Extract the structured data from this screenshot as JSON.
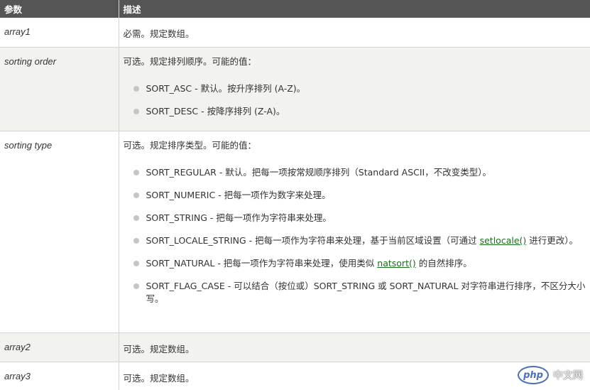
{
  "header": {
    "col_param": "参数",
    "col_desc": "描述"
  },
  "rows": [
    {
      "param": "array1",
      "desc": "必需。规定数组。"
    },
    {
      "param": "sorting order",
      "desc": "可选。规定排列顺序。可能的值：",
      "options": [
        "SORT_ASC - 默认。按升序排列 (A-Z)。",
        "SORT_DESC - 按降序排列 (Z-A)。"
      ]
    },
    {
      "param": "sorting type",
      "desc": "可选。规定排序类型。可能的值：",
      "options": [
        "SORT_REGULAR - 默认。把每一项按常规顺序排列（Standard ASCII，不改变类型）。",
        "SORT_NUMERIC - 把每一项作为数字来处理。",
        "SORT_STRING - 把每一项作为字符串来处理。",
        {
          "before": "SORT_LOCALE_STRING - 把每一项作为字符串来处理，基于当前区域设置（可通过 ",
          "link": "setlocale()",
          "after": " 进行更改）。"
        },
        {
          "before": "SORT_NATURAL - 把每一项作为字符串来处理，使用类似 ",
          "link": "natsort()",
          "after": " 的自然排序。"
        },
        "SORT_FLAG_CASE - 可以结合（按位或）SORT_STRING 或 SORT_NATURAL 对字符串进行排序，不区分大小写。"
      ]
    },
    {
      "param": "array2",
      "desc": "可选。规定数组。"
    },
    {
      "param": "array3",
      "desc": "可选。规定数组。"
    }
  ],
  "watermark": {
    "logo": "php",
    "text": "中文网"
  },
  "colors": {
    "header_bg": "#555555",
    "shade_bg": "#f2f2ef",
    "link": "#1a6c1a",
    "bullet": "#c4c4c4"
  }
}
